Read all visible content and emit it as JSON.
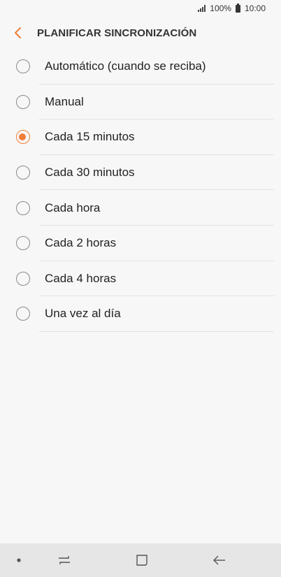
{
  "status_bar": {
    "battery_text": "100%",
    "time": "10:00"
  },
  "header": {
    "title": "PLANIFICAR SINCRONIZACIÓN",
    "back_icon": "chevron-left-icon"
  },
  "options": [
    {
      "label": "Automático (cuando se reciba)",
      "checked": false
    },
    {
      "label": "Manual",
      "checked": false
    },
    {
      "label": "Cada 15 minutos",
      "checked": true
    },
    {
      "label": "Cada 30 minutos",
      "checked": false
    },
    {
      "label": "Cada hora",
      "checked": false
    },
    {
      "label": "Cada 2 horas",
      "checked": false
    },
    {
      "label": "Cada 4 horas",
      "checked": false
    },
    {
      "label": "Una vez al día",
      "checked": false
    }
  ],
  "nav_bar": {
    "icons": [
      "dot-icon",
      "recent-apps-icon",
      "home-icon",
      "back-arrow-icon"
    ]
  },
  "colors": {
    "accent": "#f07d3a",
    "background": "#f7f7f7",
    "nav_background": "#e6e6e6"
  }
}
